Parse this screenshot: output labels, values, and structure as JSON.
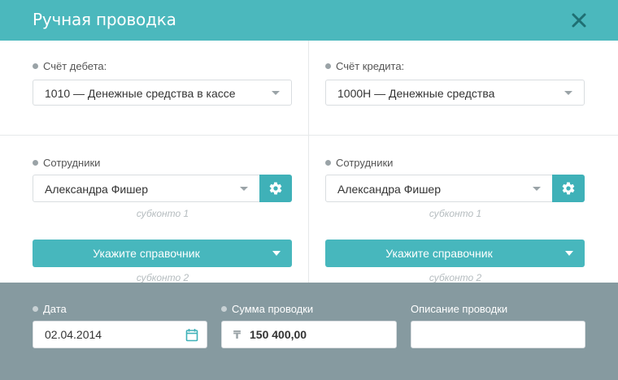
{
  "dialog": {
    "title": "Ручная проводка"
  },
  "debit": {
    "label": "Счёт дебета:",
    "value": "1010 — Денежные средства в кассе"
  },
  "credit": {
    "label": "Счёт кредита:",
    "value": "1000Н — Денежные средства"
  },
  "left_subconto": {
    "label": "Сотрудники",
    "value": "Александра Фишер",
    "hint1": "субконто 1",
    "ref_button": "Укажите справочник",
    "hint2": "субконто 2"
  },
  "right_subconto": {
    "label": "Сотрудники",
    "value": "Александра Фишер",
    "hint1": "субконто 1",
    "ref_button": "Укажите справочник",
    "hint2": "субконто 2"
  },
  "footer": {
    "date_label": "Дата",
    "date_value": "02.04.2014",
    "sum_label": "Сумма проводки",
    "currency_symbol": "₸",
    "sum_value": "150 400,00",
    "desc_label": "Описание проводки",
    "desc_value": ""
  },
  "colors": {
    "accent": "#4bb8bd",
    "footer_bg": "#869aa0"
  },
  "icons": {
    "close": "close-icon",
    "gear": "gear-icon",
    "calendar": "calendar-icon",
    "currency": "tenge-icon"
  }
}
